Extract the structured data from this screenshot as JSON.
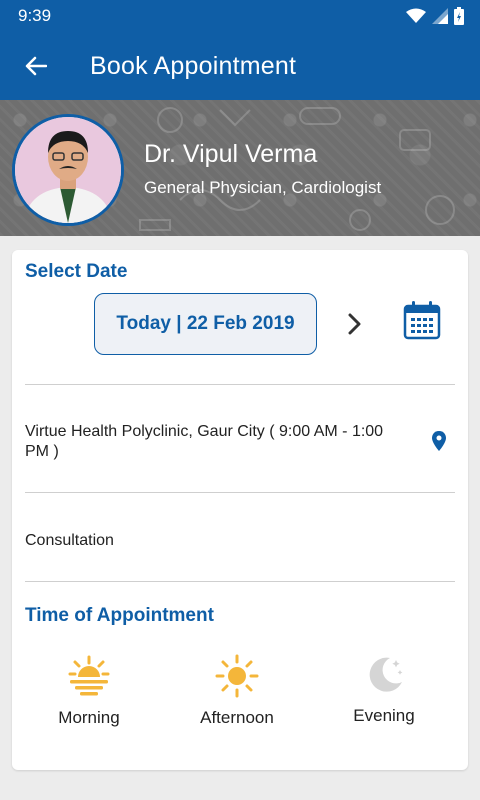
{
  "status_bar": {
    "time": "9:39"
  },
  "header": {
    "title": "Book Appointment"
  },
  "doctor": {
    "name": "Dr. Vipul Verma",
    "specialty": "General Physician, Cardiologist"
  },
  "select_date": {
    "heading": "Select Date",
    "date_label": "Today | 22 Feb 2019"
  },
  "clinic": {
    "text": "Virtue Health Polyclinic, Gaur City ( 9:00 AM - 1:00 PM )"
  },
  "service": {
    "label": "Consultation"
  },
  "time_of_appointment": {
    "heading": "Time of Appointment",
    "slots": [
      {
        "label": "Morning",
        "icon": "sunrise-icon"
      },
      {
        "label": "Afternoon",
        "icon": "sun-icon"
      },
      {
        "label": "Evening",
        "icon": "moon-icon"
      }
    ]
  },
  "colors": {
    "primary": "#0f5ea6",
    "sun": "#f4b63a",
    "moon_inactive": "#d5d5d5",
    "background": "#ececec"
  }
}
